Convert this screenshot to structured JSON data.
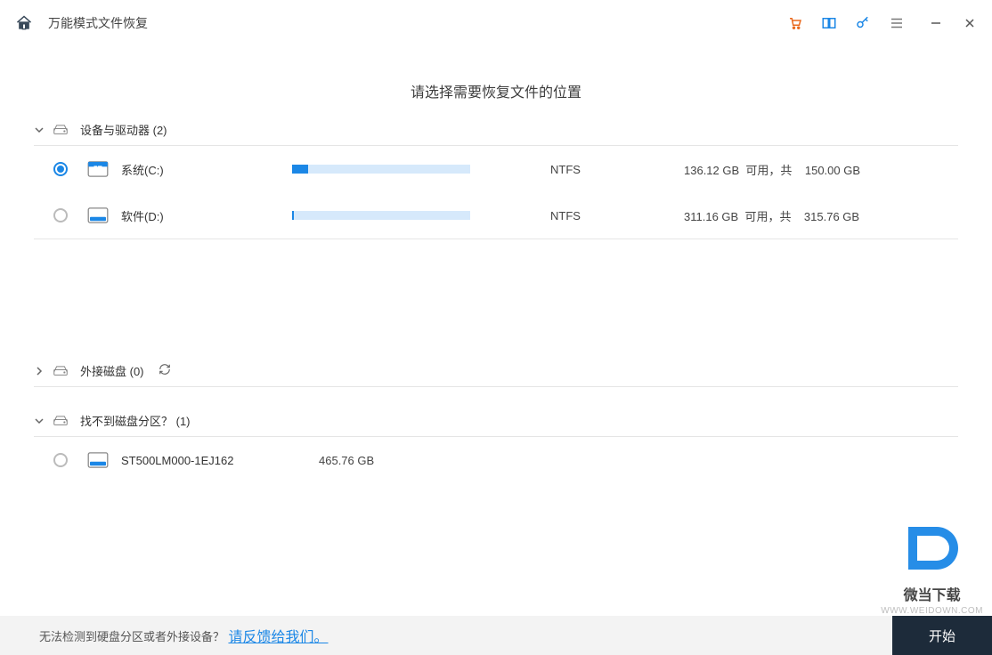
{
  "titlebar": {
    "title": "万能模式文件恢复"
  },
  "heading": "请选择需要恢复文件的位置",
  "sections": {
    "devices": {
      "label": "设备与驱动器 (2)",
      "expanded": true
    },
    "external": {
      "label": "外接磁盘 (0)",
      "expanded": false
    },
    "lost": {
      "label": "找不到磁盘分区？ (1)",
      "expanded": true
    }
  },
  "drives": [
    {
      "name": "系统(C:)",
      "fs": "NTFS",
      "free": "136.12 GB",
      "avail_label": "可用，共",
      "total": "150.00 GB",
      "selected": true,
      "fill_pct": 9,
      "icon": "windows"
    },
    {
      "name": "软件(D:)",
      "fs": "NTFS",
      "free": "311.16 GB",
      "avail_label": "可用，共",
      "total": "315.76 GB",
      "selected": false,
      "fill_pct": 1,
      "icon": "disk"
    }
  ],
  "lost_partitions": [
    {
      "name": "ST500LM000-1EJ162",
      "size": "465.76 GB",
      "selected": false
    }
  ],
  "footer": {
    "text": "无法检测到硬盘分区或者外接设备？",
    "link": "请反馈给我们",
    "start": "开始"
  },
  "watermark": {
    "cn": "微当下载",
    "url": "WWW.WEIDOWN.COM"
  }
}
